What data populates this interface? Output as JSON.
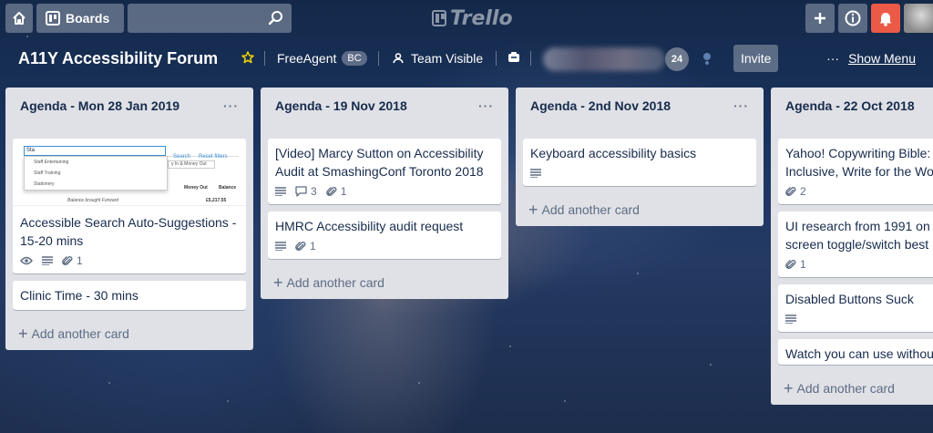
{
  "header": {
    "boards_label": "Boards",
    "search_placeholder": "",
    "logo_text": "Trello"
  },
  "board": {
    "title": "A11Y Accessibility Forum",
    "team_name": "FreeAgent",
    "team_badge": "BC",
    "visibility": "Team Visible",
    "member_count": "24",
    "invite_label": "Invite",
    "menu_dots": "···",
    "show_menu_label": "Show Menu"
  },
  "cover": {
    "input_text": "Sta",
    "search_label": "Search",
    "reset_label": "Reset filters",
    "options": [
      "Staff Entertaining",
      "Staff Training",
      "Stationery"
    ],
    "select_text": "y In & Money Out",
    "col_money_out": "Money Out",
    "col_balance": "Balance",
    "balance_text": "Balance brought Forward",
    "amount": "£5,217.55"
  },
  "lists": [
    {
      "title": "Agenda - Mon 28 Jan 2019",
      "menu": "···",
      "cards": [
        {
          "title": "Accessible Search Auto-Suggestions - 15-20 mins",
          "attachments": "1"
        },
        {
          "title": "Clinic Time - 30 mins"
        }
      ],
      "add_label": "Add another card"
    },
    {
      "title": "Agenda - 19 Nov 2018",
      "menu": "···",
      "cards": [
        {
          "title": "[Video] Marcy Sutton on Accessibility Audit at SmashingConf Toronto 2018",
          "comments": "3",
          "attachments": "1"
        },
        {
          "title": "HMRC Accessibility audit request",
          "attachments": "1"
        }
      ],
      "add_label": "Add another card"
    },
    {
      "title": "Agenda - 2nd Nov 2018",
      "menu": "···",
      "cards": [
        {
          "title": "Keyboard accessibility basics"
        }
      ],
      "add_label": "Add another card"
    },
    {
      "title": "Agenda - 22 Oct 2018",
      "cards": [
        {
          "title": "Yahoo! Copywriting Bible: Inclusive, Write for the Wo",
          "attachments": "2"
        },
        {
          "title": "UI research from 1991 on screen toggle/switch best",
          "attachments": "1"
        },
        {
          "title": "Disabled Buttons Suck"
        },
        {
          "title": "Watch you can use withou"
        }
      ],
      "add_label": "Add another card"
    }
  ],
  "colors": {
    "bell_button": "#eb5a46",
    "list_background": "#dfe1e6",
    "card_text": "#172b4d"
  }
}
